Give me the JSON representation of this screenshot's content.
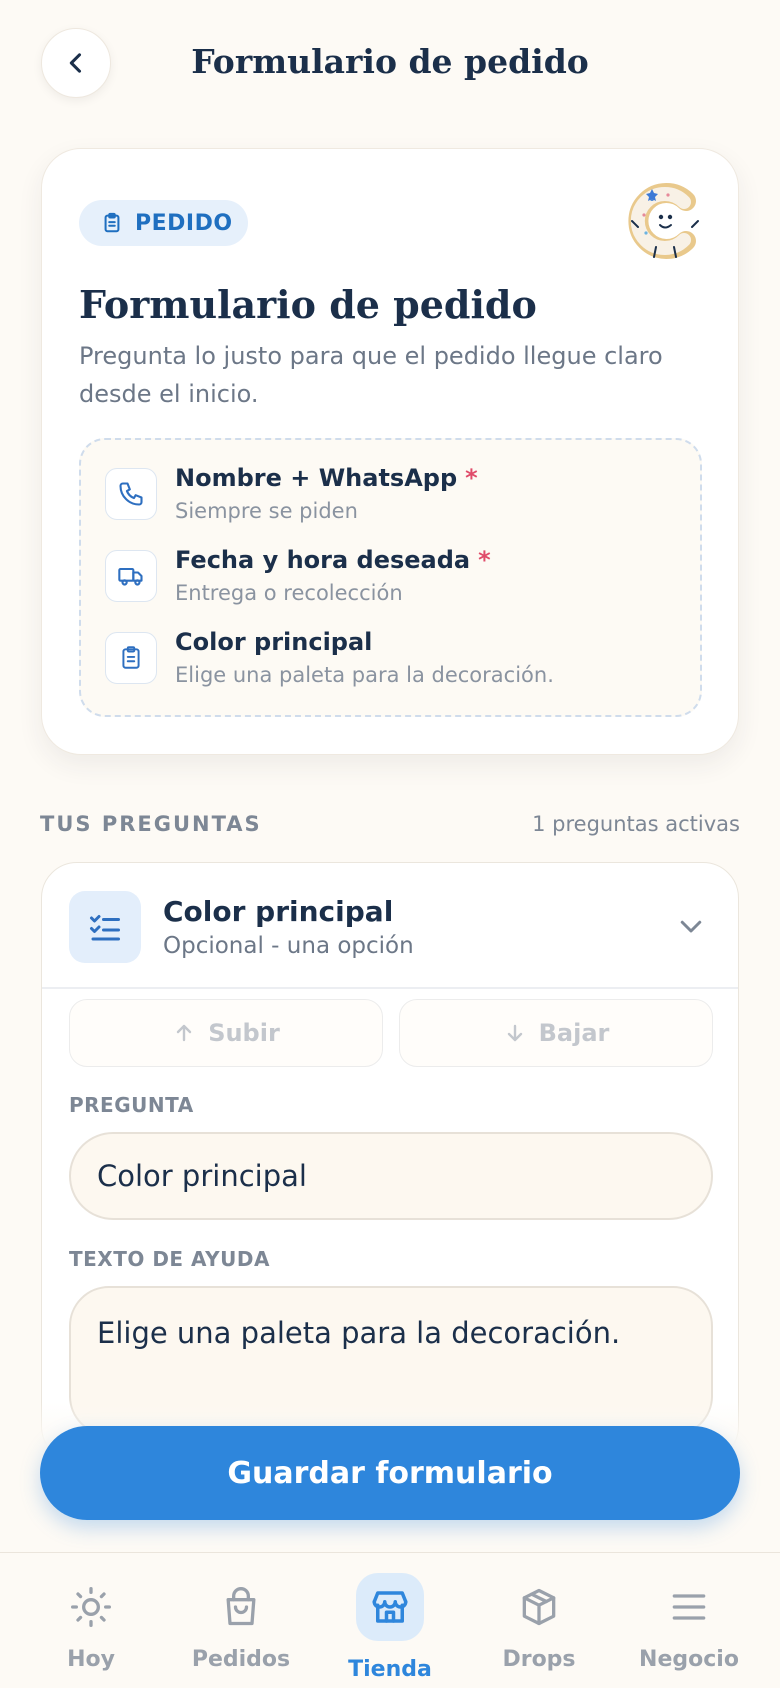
{
  "header": {
    "title": "Formulario de pedido",
    "back_icon": "chevron-left-icon"
  },
  "preview": {
    "badge": "PEDIDO",
    "title": "Formulario de pedido",
    "subtitle": "Pregunta lo justo para que el pedido llegue claro desde el inicio.",
    "fields": [
      {
        "icon": "phone-icon",
        "title": "Nombre + WhatsApp",
        "required": "*",
        "subtitle": "Siempre se piden"
      },
      {
        "icon": "truck-icon",
        "title": "Fecha y hora deseada",
        "required": "*",
        "subtitle": "Entrega o recolección"
      },
      {
        "icon": "clipboard-icon",
        "title": "Color principal",
        "required": "",
        "subtitle": "Elige una paleta para la decoración."
      }
    ]
  },
  "questions": {
    "section_label": "TUS PREGUNTAS",
    "active_count": "1 preguntas activas",
    "item": {
      "title": "Color principal",
      "subtitle": "Opcional - una opción",
      "move_up": "Subir",
      "move_down": "Bajar",
      "question_label": "PREGUNTA",
      "question_value": "Color principal",
      "help_label": "TEXTO DE AYUDA",
      "help_value": "Elige una paleta para la decoración."
    }
  },
  "save_button": "Guardar formulario",
  "nav": [
    {
      "label": "Hoy",
      "icon": "sun-icon",
      "active": false
    },
    {
      "label": "Pedidos",
      "icon": "shopping-bag-icon",
      "active": false
    },
    {
      "label": "Tienda",
      "icon": "store-icon",
      "active": true
    },
    {
      "label": "Drops",
      "icon": "box-icon",
      "active": false
    },
    {
      "label": "Negocio",
      "icon": "menu-icon",
      "active": false
    }
  ],
  "colors": {
    "accent": "#2e86dc",
    "required": "#e04b6a",
    "navy": "#1b2f4a"
  }
}
